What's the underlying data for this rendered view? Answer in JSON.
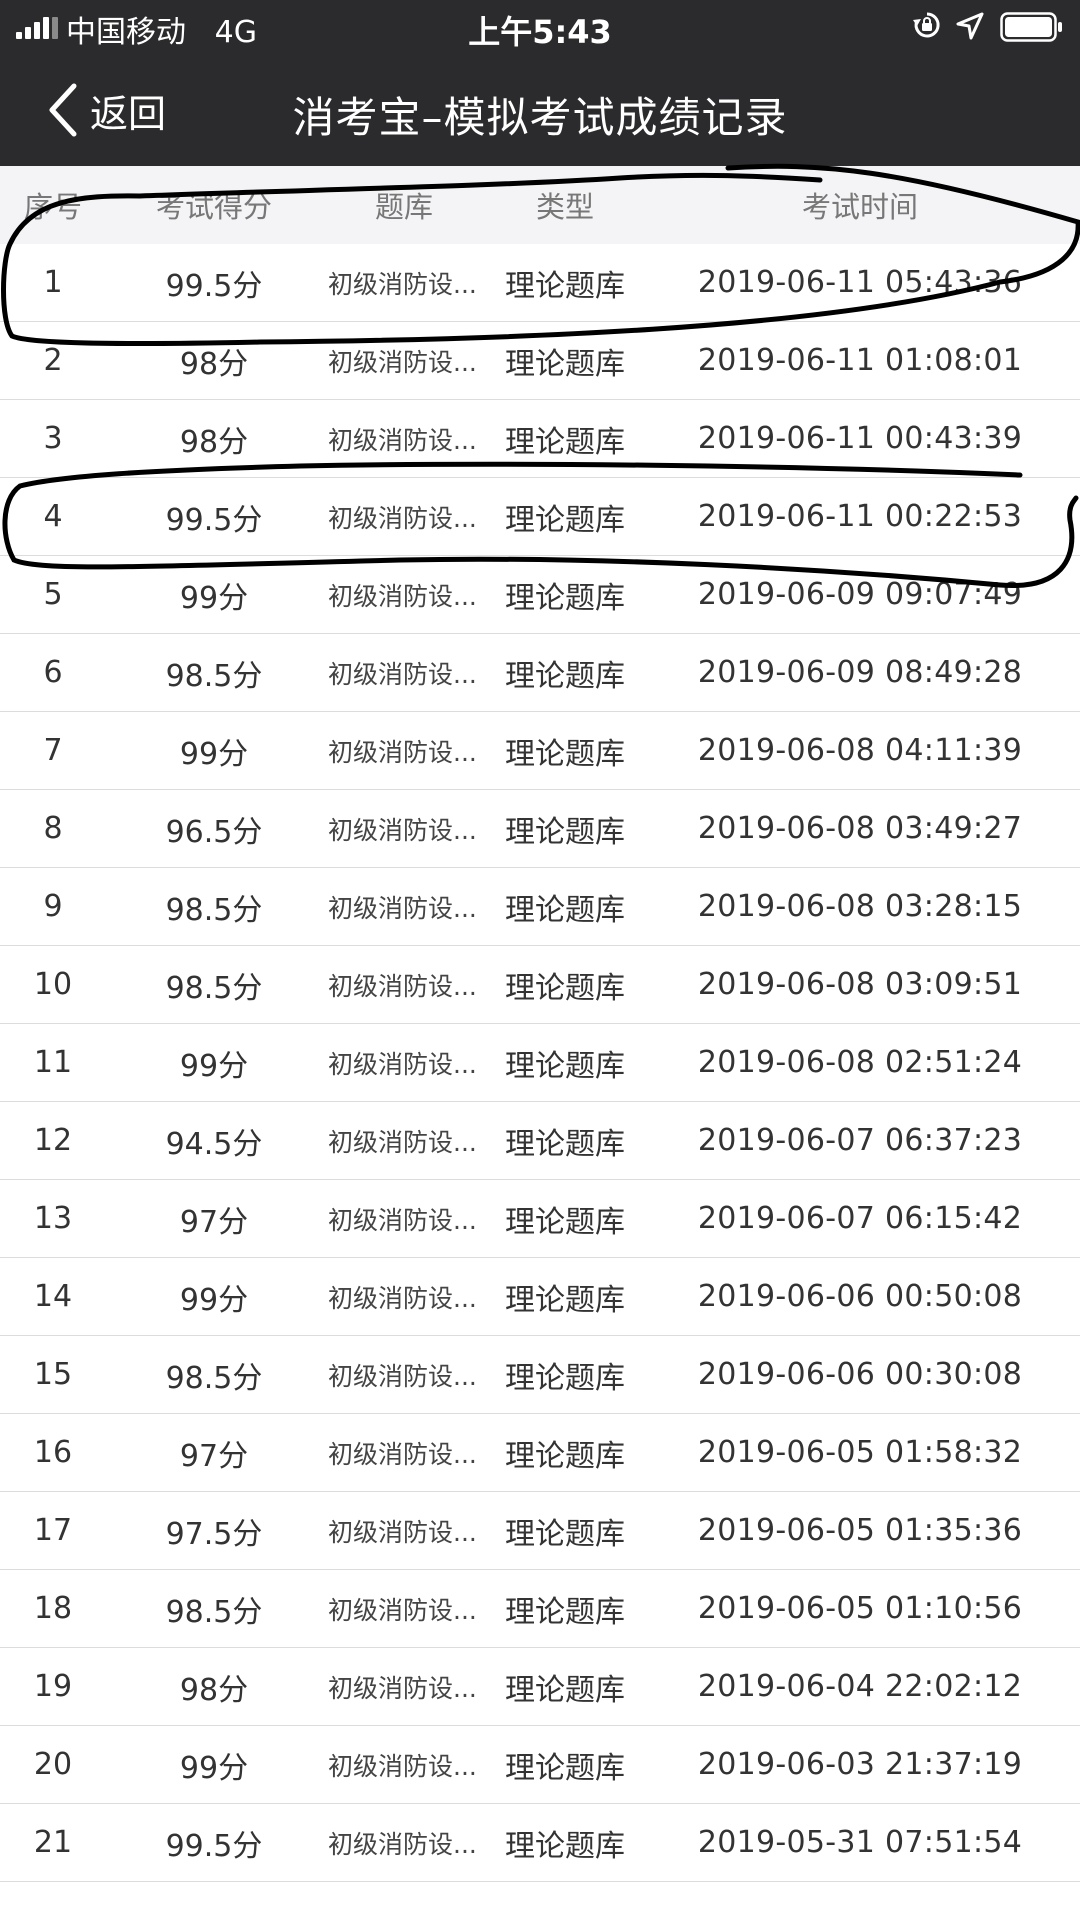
{
  "status_bar": {
    "carrier": "中国移动",
    "network": "4G",
    "time": "上午5:43",
    "icons": [
      "signal-icon",
      "rotation-lock-icon",
      "location-arrow-icon",
      "battery-icon"
    ]
  },
  "nav": {
    "back_label": "返回",
    "title": "消考宝–模拟考试成绩记录"
  },
  "table": {
    "headers": {
      "index": "序号",
      "score": "考试得分",
      "bank": "题库",
      "type": "类型",
      "time": "考试时间"
    },
    "rows": [
      {
        "index": "1",
        "score": "99.5分",
        "bank": "初级消防设...",
        "type": "理论题库",
        "time": "2019-06-11 05:43:36"
      },
      {
        "index": "2",
        "score": "98分",
        "bank": "初级消防设...",
        "type": "理论题库",
        "time": "2019-06-11 01:08:01"
      },
      {
        "index": "3",
        "score": "98分",
        "bank": "初级消防设...",
        "type": "理论题库",
        "time": "2019-06-11 00:43:39"
      },
      {
        "index": "4",
        "score": "99.5分",
        "bank": "初级消防设...",
        "type": "理论题库",
        "time": "2019-06-11 00:22:53"
      },
      {
        "index": "5",
        "score": "99分",
        "bank": "初级消防设...",
        "type": "理论题库",
        "time": "2019-06-09 09:07:49"
      },
      {
        "index": "6",
        "score": "98.5分",
        "bank": "初级消防设...",
        "type": "理论题库",
        "time": "2019-06-09 08:49:28"
      },
      {
        "index": "7",
        "score": "99分",
        "bank": "初级消防设...",
        "type": "理论题库",
        "time": "2019-06-08 04:11:39"
      },
      {
        "index": "8",
        "score": "96.5分",
        "bank": "初级消防设...",
        "type": "理论题库",
        "time": "2019-06-08 03:49:27"
      },
      {
        "index": "9",
        "score": "98.5分",
        "bank": "初级消防设...",
        "type": "理论题库",
        "time": "2019-06-08 03:28:15"
      },
      {
        "index": "10",
        "score": "98.5分",
        "bank": "初级消防设...",
        "type": "理论题库",
        "time": "2019-06-08 03:09:51"
      },
      {
        "index": "11",
        "score": "99分",
        "bank": "初级消防设...",
        "type": "理论题库",
        "time": "2019-06-08 02:51:24"
      },
      {
        "index": "12",
        "score": "94.5分",
        "bank": "初级消防设...",
        "type": "理论题库",
        "time": "2019-06-07 06:37:23"
      },
      {
        "index": "13",
        "score": "97分",
        "bank": "初级消防设...",
        "type": "理论题库",
        "time": "2019-06-07 06:15:42"
      },
      {
        "index": "14",
        "score": "99分",
        "bank": "初级消防设...",
        "type": "理论题库",
        "time": "2019-06-06 00:50:08"
      },
      {
        "index": "15",
        "score": "98.5分",
        "bank": "初级消防设...",
        "type": "理论题库",
        "time": "2019-06-06 00:30:08"
      },
      {
        "index": "16",
        "score": "97分",
        "bank": "初级消防设...",
        "type": "理论题库",
        "time": "2019-06-05 01:58:32"
      },
      {
        "index": "17",
        "score": "97.5分",
        "bank": "初级消防设...",
        "type": "理论题库",
        "time": "2019-06-05 01:35:36"
      },
      {
        "index": "18",
        "score": "98.5分",
        "bank": "初级消防设...",
        "type": "理论题库",
        "time": "2019-06-05 01:10:56"
      },
      {
        "index": "19",
        "score": "98分",
        "bank": "初级消防设...",
        "type": "理论题库",
        "time": "2019-06-04 22:02:12"
      },
      {
        "index": "20",
        "score": "99分",
        "bank": "初级消防设...",
        "type": "理论题库",
        "time": "2019-06-03 21:37:19"
      },
      {
        "index": "21",
        "score": "99.5分",
        "bank": "初级消防设...",
        "type": "理论题库",
        "time": "2019-05-31 07:51:54"
      }
    ]
  },
  "colors": {
    "header_bar": "#2b2b2d",
    "table_header_bg": "#f4f4f6",
    "marker_ink": "#000000"
  }
}
